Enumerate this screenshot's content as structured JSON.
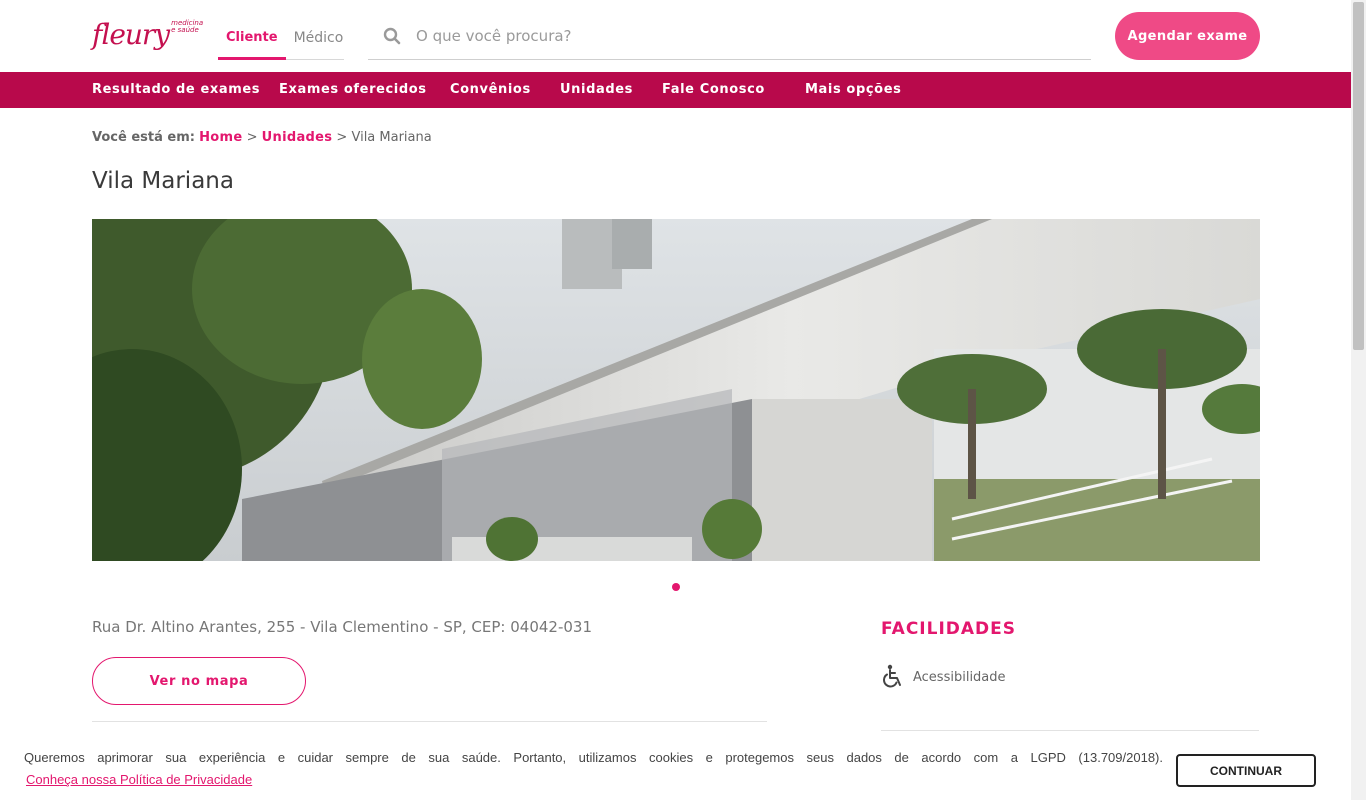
{
  "header": {
    "logo_text": "fleury",
    "logo_tagline": "medicina e saúde",
    "tabs": [
      {
        "label": "Cliente",
        "active": true
      },
      {
        "label": "Médico",
        "active": false
      }
    ],
    "search_placeholder": "O que você procura?",
    "cta_label": "Agendar exame"
  },
  "nav": {
    "items": [
      {
        "label": "Resultado de exames"
      },
      {
        "label": "Exames oferecidos"
      },
      {
        "label": "Convênios"
      },
      {
        "label": "Unidades"
      },
      {
        "label": "Fale Conosco"
      },
      {
        "label": "Mais opções"
      }
    ]
  },
  "breadcrumb": {
    "prefix": "Você está em:",
    "links": [
      "Home",
      "Unidades"
    ],
    "separator": ">",
    "current": "Vila Mariana"
  },
  "page": {
    "title": "Vila Mariana",
    "carousel": {
      "slides": 1,
      "active_index": 0
    },
    "address": "Rua Dr. Altino Arantes, 255 - Vila Clementino - SP, CEP: 04042-031",
    "map_button": "Ver no mapa",
    "facilities": {
      "title": "FACILIDADES",
      "items": [
        {
          "label": "Acessibilidade",
          "icon": "wheelchair-icon"
        }
      ]
    }
  },
  "cookie": {
    "message": "Queremos aprimorar sua experiência e cuidar sempre de sua saúde. Portanto, utilizamos cookies e protegemos seus dados de acordo com a LGPD (13.709/2018).",
    "policy_link": "Conheça nossa Política de Privacidade",
    "button": "CONTINUAR"
  },
  "colors": {
    "brand": "#e3176e",
    "nav_bg": "#b8094b",
    "cta_bg": "#ef4a86"
  }
}
